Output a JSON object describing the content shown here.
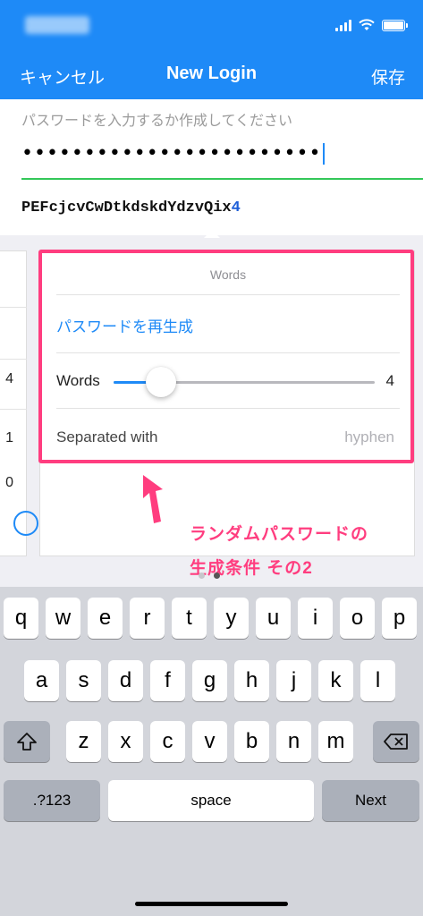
{
  "nav": {
    "cancel_label": "キャンセル",
    "title": "New Login",
    "save_label": "保存"
  },
  "form": {
    "password_placeholder": "パスワードを入力するか作成してください",
    "password_dots": "••••••••••••••••••••••••",
    "generated_password_text": "PEFcjcvCwDtkdskdYdzvQix",
    "generated_password_digit": "4"
  },
  "left_card": {
    "values": [
      "4",
      "1",
      "0"
    ]
  },
  "generator": {
    "header": "Words",
    "regenerate_label": "パスワードを再生成",
    "words_label": "Words",
    "words_value": "4",
    "slider_fraction": 0.18,
    "separated_label": "Separated with",
    "separated_value": "hyphen"
  },
  "annotation": {
    "line1": "ランダムパスワードの",
    "line2": "生成条件 その2"
  },
  "keyboard": {
    "row1": [
      "q",
      "w",
      "e",
      "r",
      "t",
      "y",
      "u",
      "i",
      "o",
      "p"
    ],
    "row2": [
      "a",
      "s",
      "d",
      "f",
      "g",
      "h",
      "j",
      "k",
      "l"
    ],
    "row3": [
      "z",
      "x",
      "c",
      "v",
      "b",
      "n",
      "m"
    ],
    "numbers_label": ".?123",
    "space_label": "space",
    "next_label": "Next"
  },
  "colors": {
    "nav_blue": "#1e8af7",
    "accent_green": "#34c759",
    "annotation_pink": "#ff3d7f"
  }
}
